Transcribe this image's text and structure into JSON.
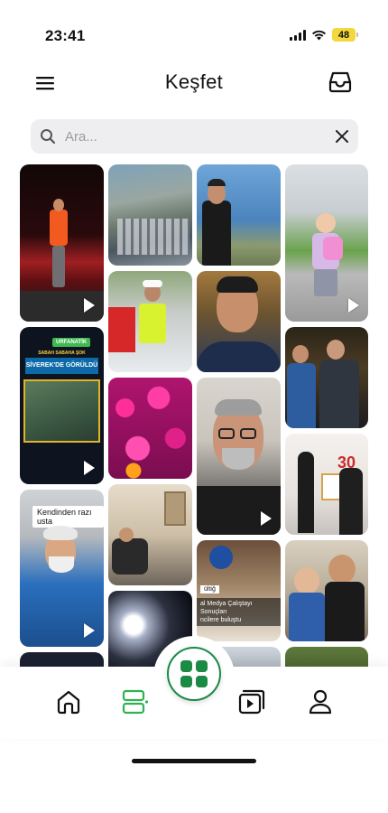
{
  "status_bar": {
    "time": "23:41",
    "battery": "48"
  },
  "header": {
    "title": "Keşfet"
  },
  "search": {
    "placeholder": "Ara..."
  },
  "tiles": {
    "news_chip": "URFANATİK",
    "news_banner_top": "SABAH SABAHA ŞOK",
    "news_banner": "SİVEREK'DE GÖRÜLDÜ",
    "caption_1": "Kendinden razı usta",
    "meeting_chip": "ültiğ",
    "meeting_caption": "al Medya Çalıştayı Sonuçları\nncilere buluştu",
    "certificate_number": "30"
  },
  "colors": {
    "accent": "#1b8a45",
    "nav_active": "#2fb24f"
  }
}
